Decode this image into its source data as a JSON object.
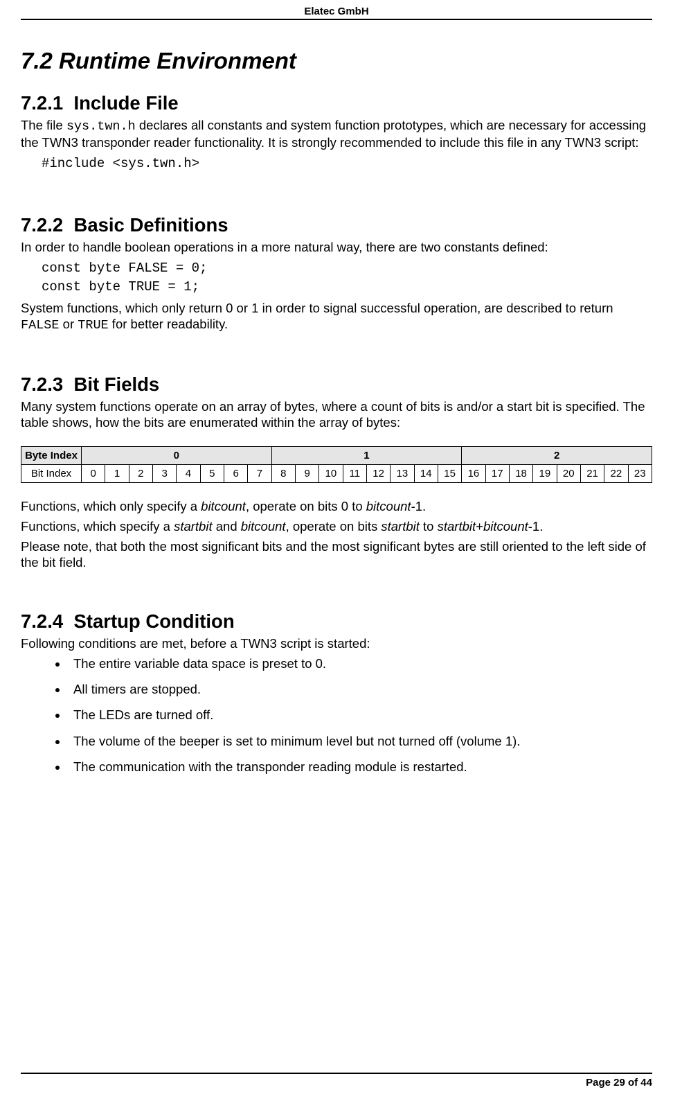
{
  "header": {
    "company": "Elatec GmbH"
  },
  "h2": {
    "number": "7.2",
    "title": "Runtime Environment"
  },
  "s1": {
    "heading_num": "7.2.1",
    "heading_title": "Include File",
    "p_pre": "The file ",
    "code_file": "sys.twn.h",
    "p_post": " declares all constants and system function prototypes, which are necessary for accessing the TWN3 transponder reader functionality. It is strongly recommended to include this file in any TWN3 script:",
    "code_line": "#include <sys.twn.h>"
  },
  "s2": {
    "heading_num": "7.2.2",
    "heading_title": "Basic Definitions",
    "p1": "In order to handle boolean operations in a more natural way, there are two constants defined:",
    "code1": "const byte FALSE = 0;",
    "code2": "const byte TRUE = 1;",
    "p2_a": "System functions, which only return 0 or 1 in order to signal successful operation, are described to return ",
    "p2_false": "FALSE",
    "p2_b": " or ",
    "p2_true": "TRUE",
    "p2_c": " for better readability."
  },
  "s3": {
    "heading_num": "7.2.3",
    "heading_title": "Bit Fields",
    "p1": "Many system functions operate on an array of bytes, where a count of bits is and/or a start bit is specified. The table shows, how the bits are enumerated within the array of bytes:",
    "table": {
      "row1_label": "Byte Index",
      "byte_indices": [
        "0",
        "1",
        "2"
      ],
      "row2_label": "Bit Index",
      "bit_indices": [
        "0",
        "1",
        "2",
        "3",
        "4",
        "5",
        "6",
        "7",
        "8",
        "9",
        "10",
        "11",
        "12",
        "13",
        "14",
        "15",
        "16",
        "17",
        "18",
        "19",
        "20",
        "21",
        "22",
        "23"
      ]
    },
    "p2_a": "Functions, which only specify a ",
    "p2_i1": "bitcount",
    "p2_b": ", operate on bits 0 to ",
    "p2_i2": "bitcount",
    "p2_c": "-1.",
    "p3_a": "Functions, which specify a ",
    "p3_i1": "startbit",
    "p3_b": " and ",
    "p3_i2": "bitcount",
    "p3_c": ", operate on bits ",
    "p3_i3": "startbit",
    "p3_d": " to ",
    "p3_i4": "startbit",
    "p3_e": "+",
    "p3_i5": "bitcount",
    "p3_f": "-1.",
    "p4": "Please note, that both the most significant bits and the most significant bytes are still oriented to the left side of the bit field."
  },
  "s4": {
    "heading_num": "7.2.4",
    "heading_title": "Startup Condition",
    "p1": "Following conditions are met, before a TWN3 script is started:",
    "bullets": [
      "The entire variable data space is preset to 0.",
      "All timers are stopped.",
      "The LEDs are turned off.",
      "The volume of the beeper is set to minimum level but not turned off (volume 1).",
      "The communication with the transponder reading module is restarted."
    ]
  },
  "footer": {
    "page": "Page 29 of 44"
  }
}
